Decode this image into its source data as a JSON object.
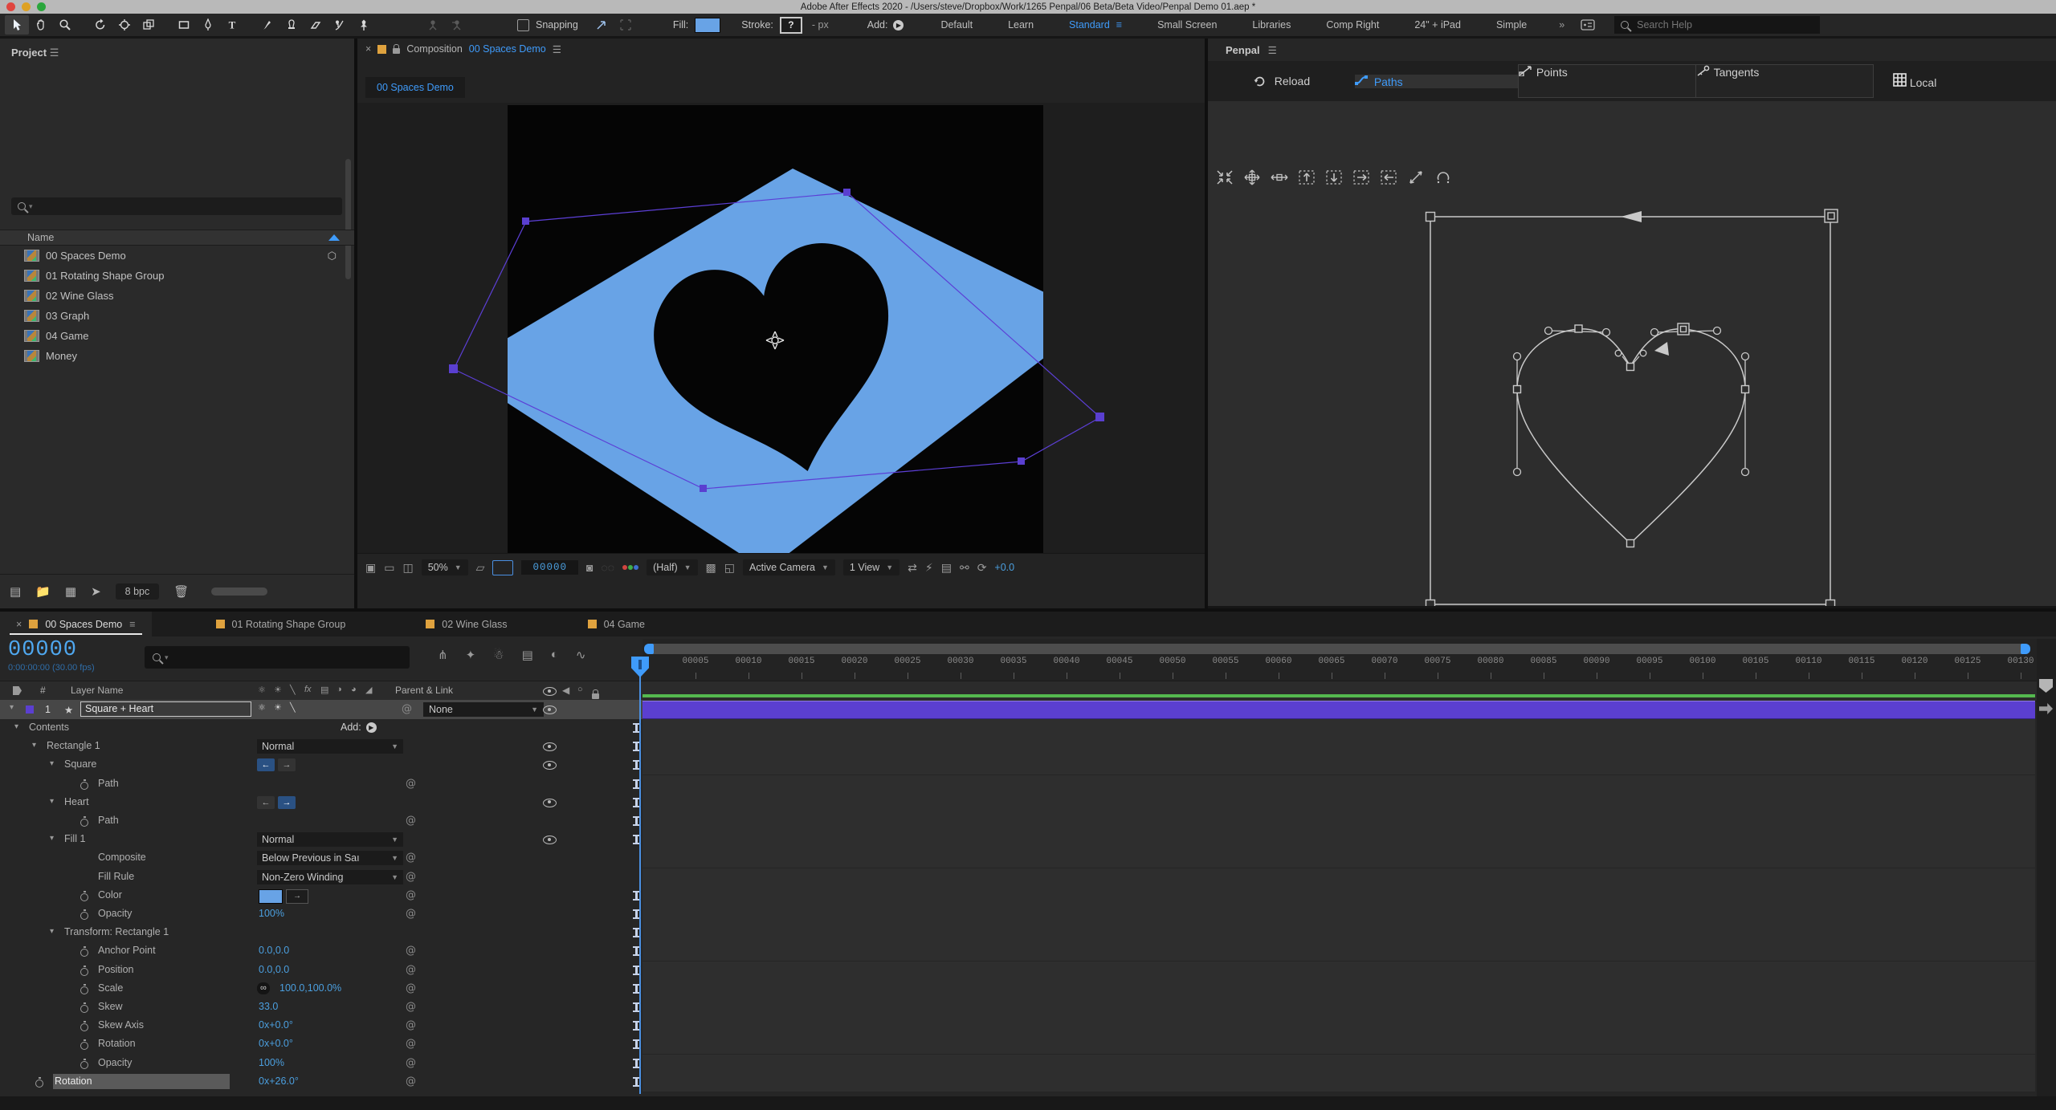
{
  "colors": {
    "accent": "#3f9bfa",
    "value_blue": "#4b9fdf",
    "shape_blue": "#68a3e6",
    "purple": "#5b3fd0",
    "green": "#55b94f",
    "orange": "#dfa23e",
    "traffic_red": "#e0453f",
    "traffic_yellow": "#dea123",
    "traffic_green": "#2aa63c"
  },
  "titlebar": {
    "title": "Adobe After Effects 2020 - /Users/steve/Dropbox/Work/1265 Penpal/06 Beta/Beta Video/Penpal Demo 01.aep *"
  },
  "toolbar": {
    "snapping": "Snapping",
    "fill": "Fill:",
    "stroke": "Stroke:",
    "stroke_value": "?",
    "px": "- px",
    "add": "Add:",
    "search": "Search Help",
    "workspaces": [
      {
        "label": "Default"
      },
      {
        "label": "Learn"
      },
      {
        "label": "Standard",
        "active": true
      },
      {
        "label": "Small Screen"
      },
      {
        "label": "Libraries"
      },
      {
        "label": "Comp Right"
      },
      {
        "label": "24\" + iPad"
      },
      {
        "label": "Simple"
      }
    ],
    "overflow": "»"
  },
  "project": {
    "title": "Project",
    "name_col": "Name",
    "bit_depth": "8 bpc",
    "items": [
      {
        "label": "00 Spaces Demo",
        "flow": true
      },
      {
        "label": "01 Rotating Shape Group"
      },
      {
        "label": "02 Wine Glass"
      },
      {
        "label": "03 Graph"
      },
      {
        "label": "04 Game"
      },
      {
        "label": "Money"
      }
    ]
  },
  "comp": {
    "close": "×",
    "label": "Composition",
    "name": "00 Spaces Demo",
    "tab": "00 Spaces Demo",
    "viewer": {
      "zoom": "50%",
      "frame": "00000",
      "resolution": "(Half)",
      "camera": "Active Camera",
      "view": "1 View",
      "exposure": "+0.0"
    }
  },
  "penpal": {
    "title": "Penpal",
    "reload": "Reload",
    "tabs": [
      {
        "label": "Paths",
        "active": true
      },
      {
        "label": "Points"
      },
      {
        "label": "Tangents"
      },
      {
        "label": "Local"
      }
    ]
  },
  "timeline": {
    "tabs": [
      {
        "label": "00 Spaces Demo",
        "active": true
      },
      {
        "label": "01 Rotating Shape Group"
      },
      {
        "label": "02 Wine Glass"
      },
      {
        "label": "04 Game"
      }
    ],
    "timecode": "00000",
    "timecode_sub": "0:00:00:00 (30.00 fps)",
    "header": {
      "hash": "#",
      "layer_name": "Layer Name",
      "parent": "Parent & Link"
    },
    "layer": {
      "num": "1",
      "name": "Square + Heart",
      "parent": "None",
      "add": "Add:"
    },
    "ruler": [
      "00005",
      "00010",
      "00015",
      "00020",
      "00025",
      "00030",
      "00035",
      "00040",
      "00045",
      "00050",
      "00055",
      "00060",
      "00065",
      "00070",
      "00075",
      "00080",
      "00085",
      "00090",
      "00095",
      "00100",
      "00105",
      "00110",
      "00115",
      "00120",
      "00125",
      "00130"
    ],
    "rows": [
      {
        "label": "Contents",
        "indent": 36,
        "twirl": true,
        "add": true,
        "beam": true
      },
      {
        "label": "Rectangle 1",
        "indent": 58,
        "twirl": true,
        "dropdown": "Normal",
        "eye": true,
        "beam": true
      },
      {
        "label": "Square",
        "indent": 80,
        "twirl": true,
        "inout": true,
        "in_active": true,
        "eye": true,
        "beam": true
      },
      {
        "label": "Path",
        "indent": 122,
        "stopwatch": true,
        "pick": true,
        "beam": true
      },
      {
        "label": "Heart",
        "indent": 80,
        "twirl": true,
        "inout": true,
        "out_active": true,
        "eye": true,
        "beam": true
      },
      {
        "label": "Path",
        "indent": 122,
        "stopwatch": true,
        "pick": true,
        "beam": true
      },
      {
        "label": "Fill 1",
        "indent": 80,
        "twirl": true,
        "dropdown": "Normal",
        "eye": true,
        "beam": true
      },
      {
        "label": "Composite",
        "indent": 122,
        "dropdown": "Below Previous in Saı",
        "pick": true
      },
      {
        "label": "Fill Rule",
        "indent": 122,
        "dropdown": "Non-Zero Winding",
        "pick": true
      },
      {
        "label": "Color",
        "indent": 122,
        "stopwatch": true,
        "swatch": true,
        "pick": true,
        "beam": true
      },
      {
        "label": "Opacity",
        "indent": 122,
        "stopwatch": true,
        "value": "100%",
        "pick": true,
        "beam": true
      },
      {
        "label": "Transform: Rectangle 1",
        "indent": 80,
        "twirl": true,
        "beam": true
      },
      {
        "label": "Anchor Point",
        "indent": 122,
        "stopwatch": true,
        "value": "0.0,0.0",
        "pick": true,
        "beam": true
      },
      {
        "label": "Position",
        "indent": 122,
        "stopwatch": true,
        "value": "0.0,0.0",
        "pick": true,
        "beam": true
      },
      {
        "label": "Scale",
        "indent": 122,
        "stopwatch": true,
        "link": true,
        "value": "100.0,100.0%",
        "pick": true,
        "beam": true
      },
      {
        "label": "Skew",
        "indent": 122,
        "stopwatch": true,
        "value": "33.0",
        "pick": true,
        "beam": true
      },
      {
        "label": "Skew Axis",
        "indent": 122,
        "stopwatch": true,
        "value": "0x+0.0°",
        "pick": true,
        "beam": true
      },
      {
        "label": "Rotation",
        "indent": 122,
        "stopwatch": true,
        "value": "0x+0.0°",
        "pick": true,
        "beam": true
      },
      {
        "label": "Opacity",
        "indent": 122,
        "stopwatch": true,
        "value": "100%",
        "pick": true,
        "beam": true
      },
      {
        "label": "Rotation",
        "indent": 66,
        "stopwatch": true,
        "value": "0x+26.0°",
        "pick": true,
        "selected": true,
        "beam": true
      }
    ]
  }
}
